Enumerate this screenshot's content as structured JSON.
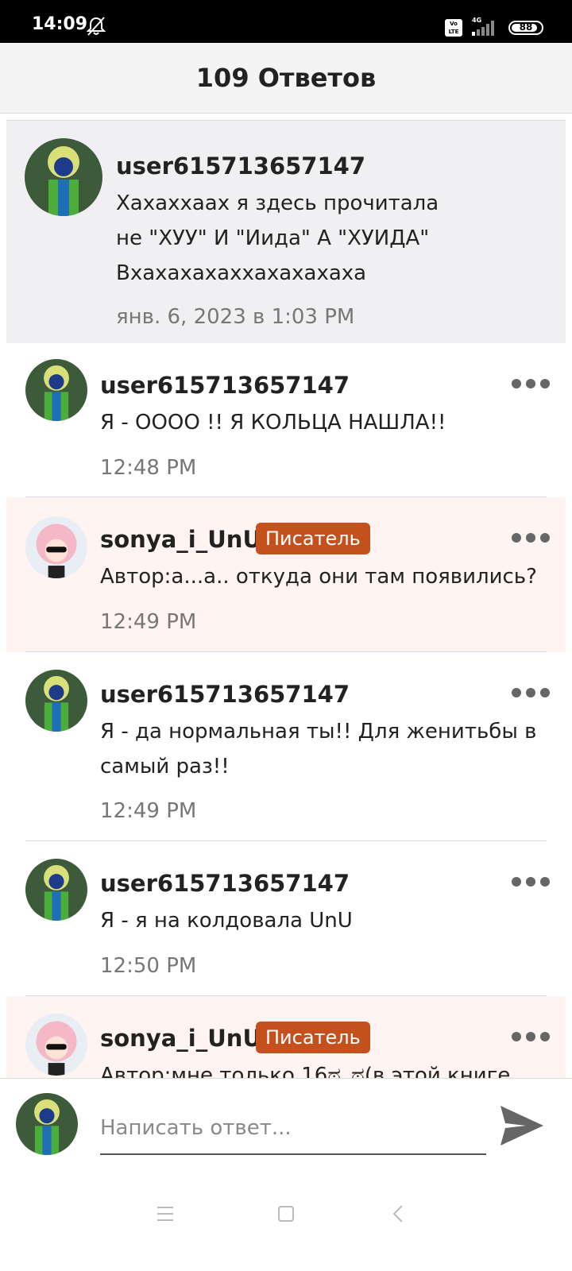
{
  "status_bar": {
    "time": "14:09",
    "volte": "Vo LTE",
    "network": "4G",
    "battery": "88",
    "battery_fraction": 0.88
  },
  "header": {
    "title": "109 Ответов"
  },
  "original_comment": {
    "username": "user615713657147",
    "text": "Хахаххаах я здесь прочитала не \"ХУУ\" И \"Иида\" А \"ХУИДА\" Вхахахахаххахахахаха",
    "date": "янв. 6, 2023 в 1:03 PM"
  },
  "replies": [
    {
      "username": "user615713657147",
      "badge": "",
      "text": "Я - ОООО !! Я КОЛЬЦА НАШЛА!!",
      "time": "12:48 PM"
    },
    {
      "username": "sonya_i_UnU",
      "badge": "Писатель",
      "text": "Автор:а...а.. откуда они там появились?",
      "time": "12:49 PM"
    },
    {
      "username": "user615713657147",
      "badge": "",
      "text": "Я - да нормальная ты!! Для женитьбы в самый раз!!",
      "time": "12:49 PM"
    },
    {
      "username": "user615713657147",
      "badge": "",
      "text": "Я - я на колдовала UnU",
      "time": "12:50 PM"
    },
    {
      "username": "sonya_i_UnU",
      "badge": "Писатель",
      "text": "Автор:мне только 16ಥ_ಥ(в этой книге",
      "time": ""
    }
  ],
  "reply_bar": {
    "placeholder": "Написать ответ..."
  },
  "colors": {
    "writer_badge": "#c4501e",
    "writer_bg": "#fff4f1",
    "original_bg": "#f0eff1",
    "send": "#666666"
  },
  "icons": [
    "silent-bell-icon",
    "volte-icon",
    "signal-icon",
    "battery-icon",
    "more-options-icon",
    "send-icon",
    "menu-icon",
    "home-icon",
    "back-icon"
  ]
}
